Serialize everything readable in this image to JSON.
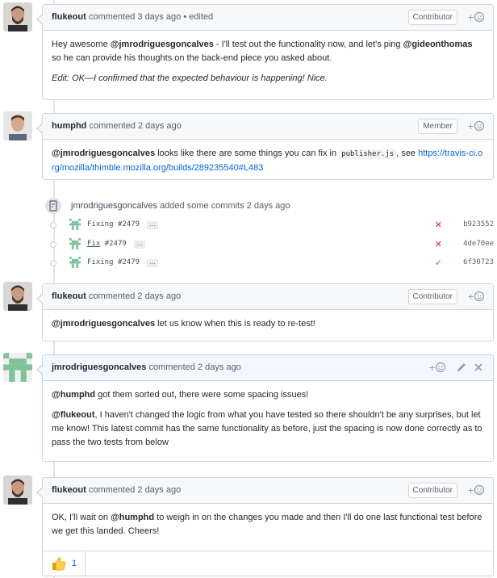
{
  "comments": [
    {
      "author": "flukeout",
      "action": "commented",
      "time": "3 days ago",
      "edited": "• edited",
      "badge": "Contributor",
      "body": {
        "p1a": "Hey awesome ",
        "m1": "@jmrodriguesgoncalves",
        "p1b": " - I'll test out the functionality now, and let's ping ",
        "m2": "@gideonthomas",
        "p1c": " so he can provide his thoughts on the back-end piece you asked about.",
        "p2": "Edit: OK—I confirmed that the expected behaviour is happening! Nice."
      }
    },
    {
      "author": "humphd",
      "action": "commented",
      "time": "2 days ago",
      "badge": "Member",
      "body": {
        "m1": "@jmrodriguesgoncalves",
        "t1": " looks like there are some things you can fix in ",
        "code": "publisher.js",
        "t2": ", see ",
        "link": "https://travis-ci.org/mozilla/thimble.mozilla.org/builds/289235540#L483"
      }
    },
    {
      "author": "flukeout",
      "action": "commented",
      "time": "2 days ago",
      "badge": "Contributor",
      "body": {
        "m1": "@jmrodriguesgoncalves",
        "t1": " let us know when this is ready to re-test!"
      }
    },
    {
      "author": "jmrodriguesgoncalves",
      "action": "commented",
      "time": "2 days ago",
      "body": {
        "m1": "@humphd",
        "t1": " got them sorted out, there were some spacing issues!",
        "m2": "@flukeout",
        "t2": ", I haven't changed the logic from what you have tested so there shouldn't be any surprises, but let me know! This latest commit has the same functionality as before, just the spacing is now done correctly as to pass the two tests from below"
      }
    },
    {
      "author": "flukeout",
      "action": "commented",
      "time": "2 days ago",
      "badge": "Contributor",
      "body": {
        "t1": "OK, I'll wait on ",
        "m1": "@humphd",
        "t2": " to weigh in on the changes you made and then I'll do one last functional test before we get this landed. Cheers!"
      },
      "reaction": {
        "icon": "thumbs-up",
        "count": "1"
      }
    }
  ],
  "commit_event": {
    "author": "jmrodriguesgoncalves",
    "text": "added some commits",
    "time": "2 days ago",
    "commits": [
      {
        "prefix": "Fixing",
        "issue": "#2479",
        "status": "fail",
        "sha": "b923552"
      },
      {
        "prefix": "Fix",
        "issue": "#2479",
        "status": "fail",
        "sha": "4de70ee"
      },
      {
        "prefix": "Fixing",
        "issue": "#2479",
        "status": "success",
        "sha": "6f30723"
      }
    ]
  },
  "colors": {
    "fail": "#cb2431",
    "success": "#28a745",
    "link": "#0366d6"
  }
}
